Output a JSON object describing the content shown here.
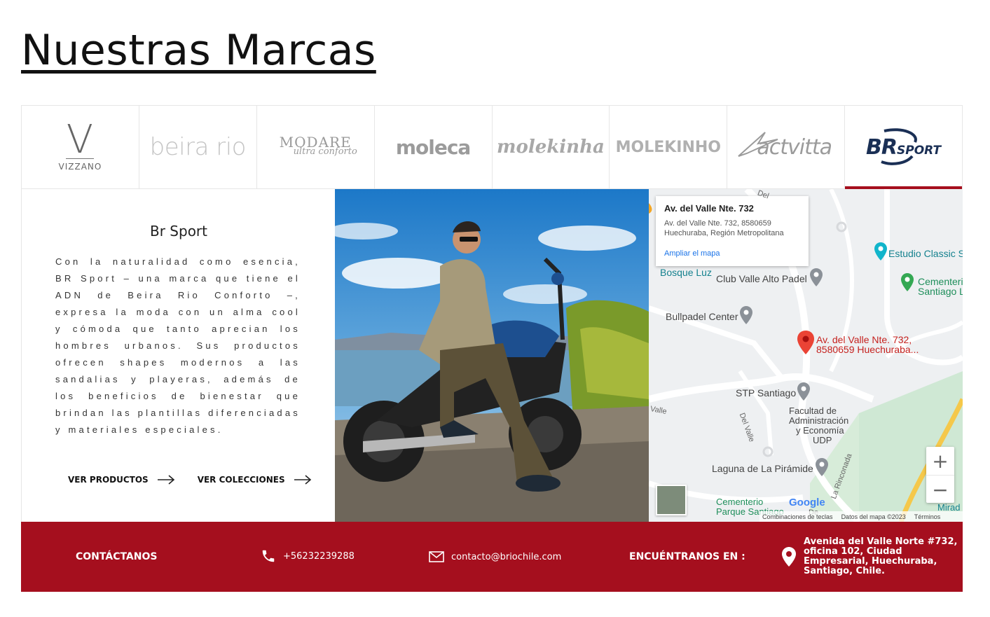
{
  "page": {
    "title": "Nuestras Marcas"
  },
  "brands": [
    {
      "name": "Vizzano",
      "logo_text": "VIZZANO",
      "logo_mark": "V",
      "active": false
    },
    {
      "name": "Beira Rio",
      "logo_text": "beira rio",
      "active": false
    },
    {
      "name": "Modare",
      "logo_text": "MODARE",
      "logo_subtext": "ultra conforto",
      "active": false
    },
    {
      "name": "Moleca",
      "logo_text": "moleca",
      "active": false
    },
    {
      "name": "Molekinha",
      "logo_text": "molekinha",
      "active": false
    },
    {
      "name": "Molekinho",
      "logo_text": "MOLEKINHO",
      "active": false
    },
    {
      "name": "Actvitta",
      "logo_text": "actvitta",
      "active": false
    },
    {
      "name": "BR Sport",
      "logo_text": "BR",
      "logo_subtext": "SPORT",
      "active": true
    }
  ],
  "selected_brand": {
    "name": "Br Sport",
    "description": "Con la naturalidad como esencia, BR Sport – una marca que tiene el ADN de Beira Rio Conforto –, expresa la moda con un alma cool y cómoda que tanto aprecian los hombres urbanos. Sus productos ofrecen shapes modernos a las sandalias y playeras, además de los beneficios de bienestar que brindan las plantillas diferenciadas y materiales especiales.",
    "links": [
      {
        "label": "VER PRODUCTOS"
      },
      {
        "label": "VER COLECCIONES"
      }
    ]
  },
  "map": {
    "card_title": "Av. del Valle Nte. 732",
    "card_address_line1": "Av. del Valle Nte. 732, 8580659",
    "card_address_line2": "Huechuraba, Región Metropolitana",
    "card_link": "Ampliar el mapa",
    "pin_label_line1": "Av. del Valle Nte. 732,",
    "pin_label_line2": "8580659 Huechuraba...",
    "places": {
      "estudio": "Estudio Classic S",
      "cementerio1_line1": "Cementeri",
      "cementerio1_line2": "Santiago L",
      "bosque": "Bosque Luz",
      "club": "Club Valle Alto Padel",
      "bullpadel": "Bullpadel Center",
      "stp": "STP Santiago",
      "facultad_l1": "Facultad de",
      "facultad_l2": "Administración",
      "facultad_l3": "y Economía",
      "facultad_l4": "UDP",
      "laguna": "Laguna de La Pirámide",
      "cementerio2_line1": "Cementerio",
      "cementerio2_line2": "Parque Santiago",
      "mirad": "Mirad",
      "delvalle": "Del Valle",
      "valle": "Valle",
      "rinconada": "La Rinconada",
      "de": "Del",
      "de2": "De"
    },
    "google_logo": "Google",
    "attribution_keys": "Combinaciones de teclas",
    "attribution_data": "Datos del mapa ©2023",
    "attribution_terms": "Términos",
    "zoom_in": "+",
    "zoom_out": "−"
  },
  "footer": {
    "contact_label": "CONTÁCTANOS",
    "phone": "+56232239288",
    "email": "contacto@briochile.com",
    "find_label": "ENCUÉNTRANOS EN :",
    "address_line1": "Avenida del Valle Norte #732,",
    "address_line2": "oficina 102, Ciudad",
    "address_line3": "Empresarial, Huechuraba,",
    "address_line4": "Santiago, Chile."
  },
  "colors": {
    "accent": "#a50f1e",
    "brsport_navy": "#1a2f55"
  },
  "icons": [
    "arrow-right-icon",
    "phone-icon",
    "mail-icon",
    "location-pin-icon",
    "map-pin-icon",
    "zoom-in-icon",
    "zoom-out-icon"
  ]
}
